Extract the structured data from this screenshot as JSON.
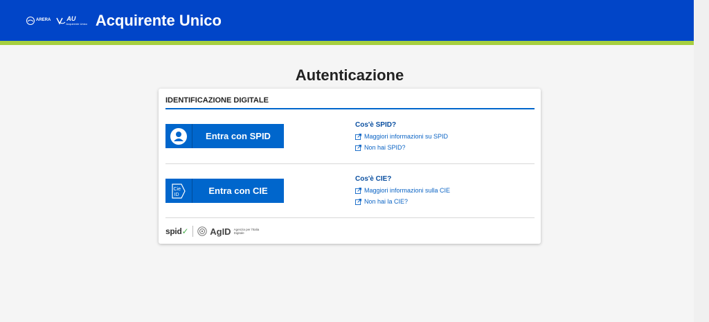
{
  "header": {
    "arera_label": "ARERA",
    "au_label": "AU",
    "au_sub": "Acquirente Unico",
    "title": "Acquirente Unico",
    "colors": {
      "primary": "#0145c8",
      "accent": "#a6cf3f"
    }
  },
  "page": {
    "title": "Autenticazione"
  },
  "card": {
    "heading": "IDENTIFICAZIONE DIGITALE",
    "spid": {
      "button_label": "Entra con SPID",
      "icon": "user-circle-icon",
      "info_title": "Cos'è SPID?",
      "links": [
        "Maggiori informazioni su SPID",
        "Non hai SPID?"
      ]
    },
    "cie": {
      "button_label": "Entra con CIE",
      "icon": "cie-id-icon",
      "icon_text": "Cie ID",
      "info_title": "Cos'è CIE?",
      "links": [
        "Maggiori informazioni sulla CIE",
        "Non hai la CIE?"
      ]
    },
    "footer": {
      "spid_logo": "spid",
      "agid_logo": "AgID",
      "agid_sub": "Agenzia per l'Italia Digitale"
    }
  }
}
